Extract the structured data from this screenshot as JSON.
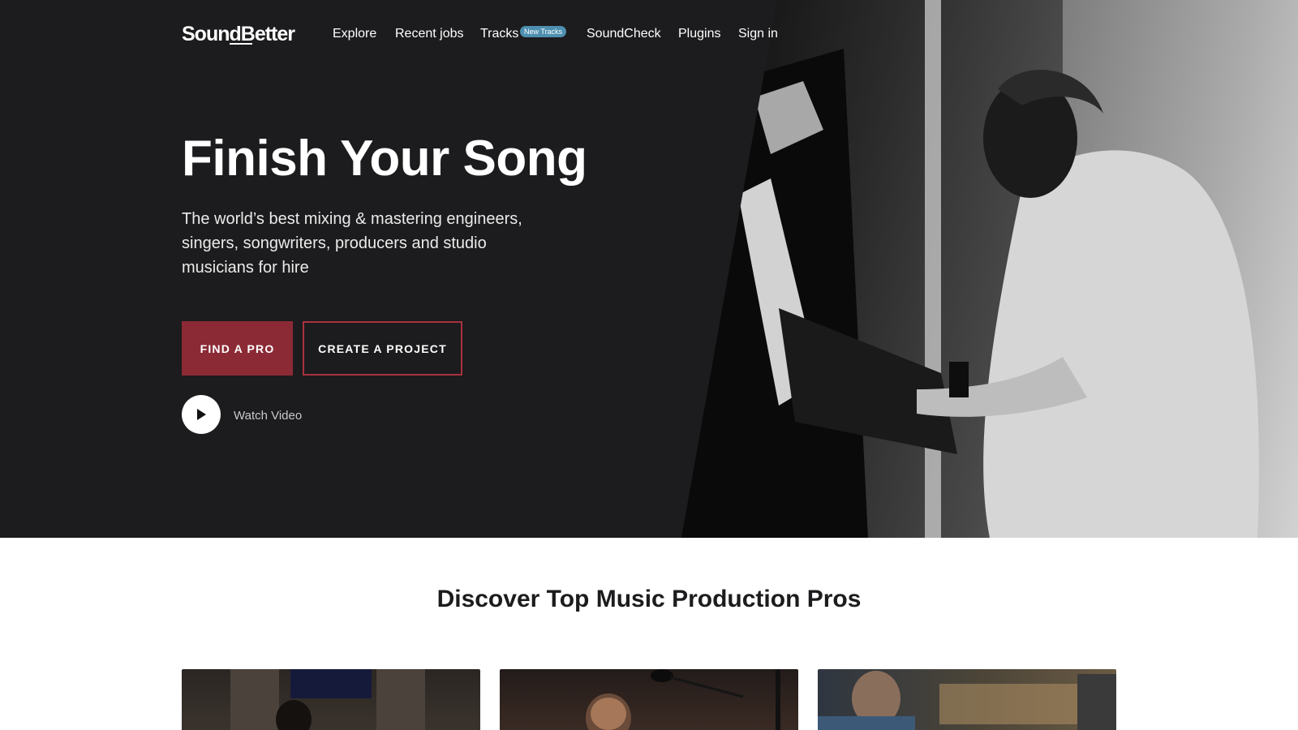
{
  "brand": {
    "logo_text": "SoundBetter"
  },
  "nav": {
    "items": [
      {
        "label": "Explore"
      },
      {
        "label": "Recent jobs"
      },
      {
        "label": "Tracks"
      },
      {
        "label": "SoundCheck"
      },
      {
        "label": "Plugins"
      },
      {
        "label": "Sign in"
      }
    ],
    "tracks_badge": "New Tracks"
  },
  "hero": {
    "title": "Finish Your Song",
    "subtitle": "The world’s best mixing & mastering engineers, singers, songwriters, producers and studio musicians for hire",
    "primary_button": "FIND A PRO",
    "secondary_button": "CREATE A PROJECT",
    "watch_label": "Watch Video",
    "play_icon": "play-icon",
    "photo_subject": "pianist-photo"
  },
  "discover": {
    "title": "Discover Top Music Production Pros",
    "cards": [
      {
        "image": "studio-musician-photo"
      },
      {
        "image": "singer-photo"
      },
      {
        "image": "engineer-photo"
      }
    ]
  },
  "colors": {
    "hero_bg": "#1c1b1d",
    "accent": "#8b2a35",
    "badge": "#4d8fb0",
    "page_bg": "#ffffff",
    "heading_dark": "#1c1c1e"
  }
}
